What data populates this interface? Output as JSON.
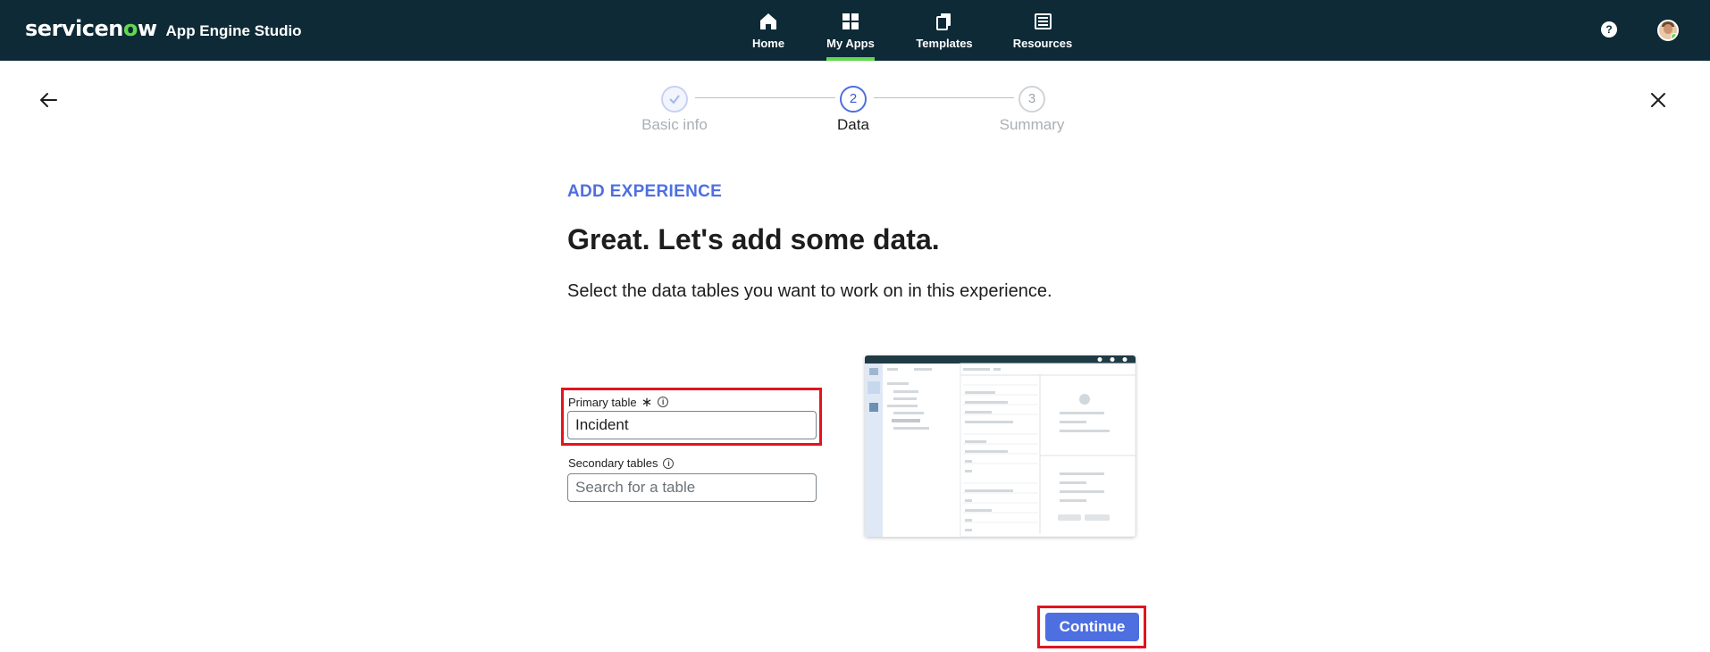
{
  "header": {
    "brand_logo": "servicenow",
    "app_title": "App Engine Studio",
    "nav": [
      {
        "label": "Home",
        "icon": "home-icon",
        "active": false
      },
      {
        "label": "My Apps",
        "icon": "grid-icon",
        "active": true
      },
      {
        "label": "Templates",
        "icon": "templates-icon",
        "active": false
      },
      {
        "label": "Resources",
        "icon": "resources-icon",
        "active": false
      }
    ],
    "help_glyph": "?",
    "colors": {
      "bar": "#0d2a36",
      "accent": "#62d84e"
    }
  },
  "stepper": {
    "steps": [
      {
        "number": "1",
        "label": "Basic info",
        "state": "done"
      },
      {
        "number": "2",
        "label": "Data",
        "state": "current"
      },
      {
        "number": "3",
        "label": "Summary",
        "state": "future"
      }
    ]
  },
  "main": {
    "eyebrow": "ADD EXPERIENCE",
    "headline": "Great. Let's add some data.",
    "subtext": "Select the data tables you want to work on in this experience.",
    "primary_table": {
      "label": "Primary table",
      "required_mark": "∗",
      "value": "Incident"
    },
    "secondary_tables": {
      "label": "Secondary tables",
      "placeholder": "Search for a table",
      "value": ""
    },
    "continue_label": "Continue",
    "accent_color": "#4e6fe0",
    "highlight_color": "#e2141f"
  }
}
